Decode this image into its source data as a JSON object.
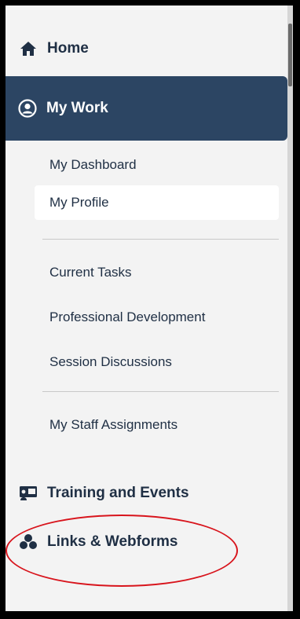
{
  "nav": {
    "home": {
      "label": "Home",
      "icon": "home-icon"
    },
    "my_work": {
      "label": "My Work",
      "icon": "user-circle-icon"
    },
    "my_work_items": [
      {
        "label": "My Dashboard"
      },
      {
        "label": "My Profile",
        "active": true
      }
    ],
    "task_items": [
      {
        "label": "Current Tasks"
      },
      {
        "label": "Professional Development"
      },
      {
        "label": "Session Discussions"
      }
    ],
    "staff_items": [
      {
        "label": "My Staff Assignments"
      }
    ],
    "training": {
      "label": "Training and Events",
      "icon": "presentation-icon"
    },
    "links": {
      "label": "Links & Webforms",
      "icon": "cubes-icon"
    }
  },
  "colors": {
    "active_bg": "#2c4563",
    "text": "#1f2f44",
    "highlight_oval": "#d8141c"
  }
}
